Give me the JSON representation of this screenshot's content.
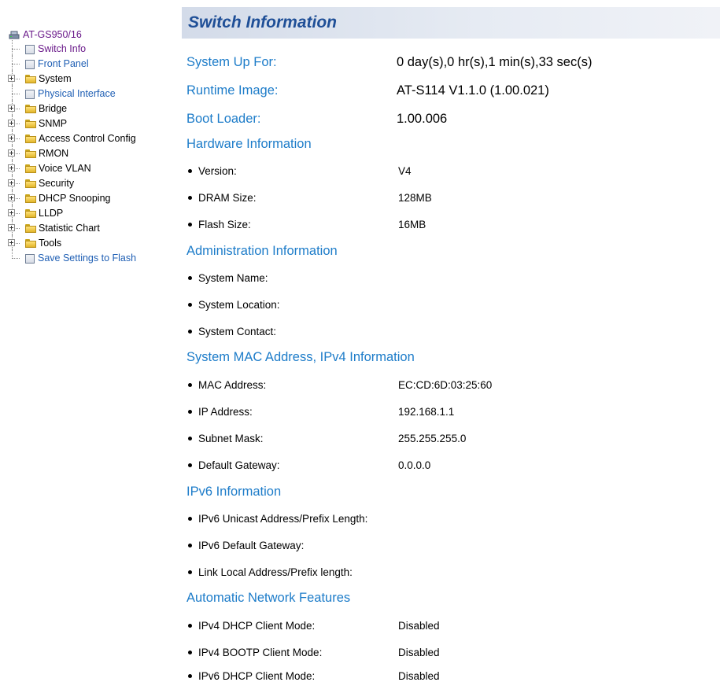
{
  "tree": {
    "root": "AT-GS950/16",
    "items": [
      {
        "label": "Switch Info",
        "kind": "page",
        "state": "visited"
      },
      {
        "label": "Front Panel",
        "kind": "page",
        "state": "link"
      },
      {
        "label": "System",
        "kind": "folder"
      },
      {
        "label": "Physical Interface",
        "kind": "page",
        "state": "link"
      },
      {
        "label": "Bridge",
        "kind": "folder"
      },
      {
        "label": "SNMP",
        "kind": "folder"
      },
      {
        "label": "Access Control Config",
        "kind": "folder"
      },
      {
        "label": "RMON",
        "kind": "folder"
      },
      {
        "label": "Voice VLAN",
        "kind": "folder"
      },
      {
        "label": "Security",
        "kind": "folder"
      },
      {
        "label": "DHCP Snooping",
        "kind": "folder"
      },
      {
        "label": "LLDP",
        "kind": "folder"
      },
      {
        "label": "Statistic Chart",
        "kind": "folder"
      },
      {
        "label": "Tools",
        "kind": "folder"
      },
      {
        "label": "Save Settings to Flash",
        "kind": "page",
        "state": "link"
      }
    ]
  },
  "header": {
    "title": "Switch Information"
  },
  "main": {
    "uptime_label": "System Up For:",
    "uptime_value": "0 day(s),0 hr(s),1 min(s),33 sec(s)",
    "runtime_label": "Runtime Image:",
    "runtime_value": "AT-S114 V1.1.0 (1.00.021)",
    "boot_label": "Boot Loader:",
    "boot_value": "1.00.006",
    "hw": {
      "title": "Hardware Information",
      "version_label": "Version:",
      "version_value": "V4",
      "dram_label": "DRAM Size:",
      "dram_value": "128MB",
      "flash_label": "Flash Size:",
      "flash_value": "16MB"
    },
    "admin": {
      "title": "Administration Information",
      "name_label": "System Name:",
      "location_label": "System Location:",
      "contact_label": "System Contact:"
    },
    "ipv4": {
      "title": "System MAC Address, IPv4 Information",
      "mac_label": "MAC Address:",
      "mac_value": "EC:CD:6D:03:25:60",
      "ip_label": "IP Address:",
      "ip_value": "192.168.1.1",
      "mask_label": "Subnet Mask:",
      "mask_value": "255.255.255.0",
      "gw_label": "Default Gateway:",
      "gw_value": "0.0.0.0"
    },
    "ipv6": {
      "title": "IPv6 Information",
      "unicast_label": "IPv6 Unicast Address/Prefix Length:",
      "gw_label": "IPv6 Default Gateway:",
      "linklocal_label": "Link Local Address/Prefix length:"
    },
    "auto": {
      "title": "Automatic Network Features",
      "dhcp4_label": "IPv4 DHCP Client Mode:",
      "dhcp4_value": "Disabled",
      "bootp_label": "IPv4 BOOTP Client Mode:",
      "bootp_value": "Disabled",
      "dhcp6_label": "IPv6 DHCP Client Mode:",
      "dhcp6_value": "Disabled"
    }
  }
}
